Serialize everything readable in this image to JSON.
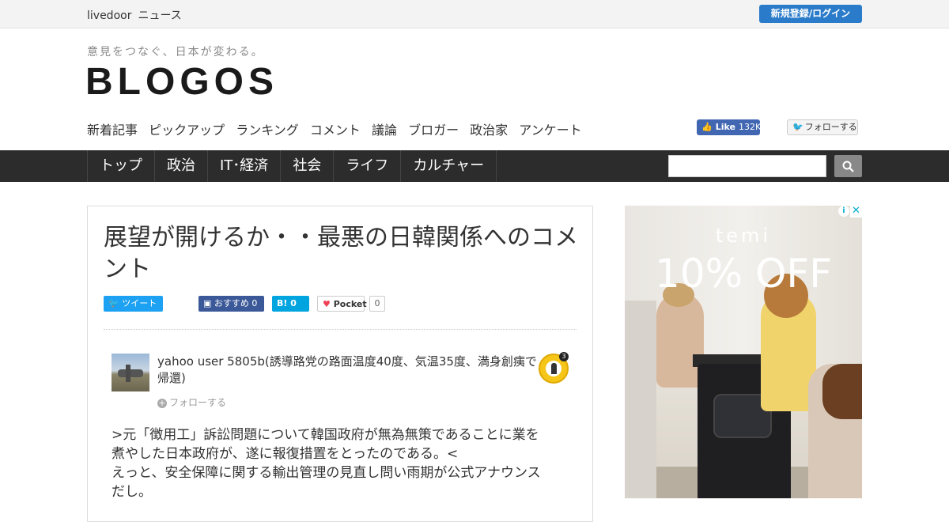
{
  "topbar": {
    "brand_livedoor": "livedoor",
    "brand_news": "ニュース",
    "login_label": "新規登録/ログイン"
  },
  "header": {
    "tagline": "意見をつなぐ、日本が変わる。",
    "logo": "BLOGOS"
  },
  "subnav": {
    "items": [
      "新着記事",
      "ピックアップ",
      "ランキング",
      "コメント",
      "議論",
      "ブロガー",
      "政治家",
      "アンケート"
    ]
  },
  "social": {
    "fb_like_label": "Like",
    "fb_like_count": "132K",
    "tw_follow_label": "フォローする"
  },
  "mainnav": {
    "items": [
      "トップ",
      "政治",
      "IT･経済",
      "社会",
      "ライフ",
      "カルチャー"
    ]
  },
  "search": {
    "placeholder": ""
  },
  "article": {
    "title": "展望が開けるか・・最悪の日韓関係へのコメント",
    "share": {
      "tweet_label": "ツイート",
      "fb_label": "おすすめ",
      "fb_count": "0",
      "hatena_label": "B!",
      "hatena_count": "0",
      "pocket_label": "Pocket",
      "pocket_count": "0"
    },
    "author": {
      "name": "yahoo user 5805b(誘導路党の路面温度40度、気温35度、満身創痍で帰還)",
      "follow_label": "フォローする",
      "badge_count": "3"
    },
    "body_lines": [
      ">元「徴用工」訴訟問題について韓国政府が無為無策であることに業を",
      "煮やした日本政府が、遂に報復措置をとったのである。<",
      "えっと、安全保障に関する輸出管理の見直し問い雨期が公式アナウンス",
      "だし。"
    ]
  },
  "ad": {
    "brand": "temi",
    "offer": "10% OFF",
    "info_icon": "i",
    "close_icon": "✕"
  },
  "colors": {
    "nav_bg": "#2c2c2c",
    "login_bg": "#2a7bc9",
    "twitter": "#1da1f2",
    "facebook": "#3b5998",
    "hatena": "#00a4de"
  }
}
